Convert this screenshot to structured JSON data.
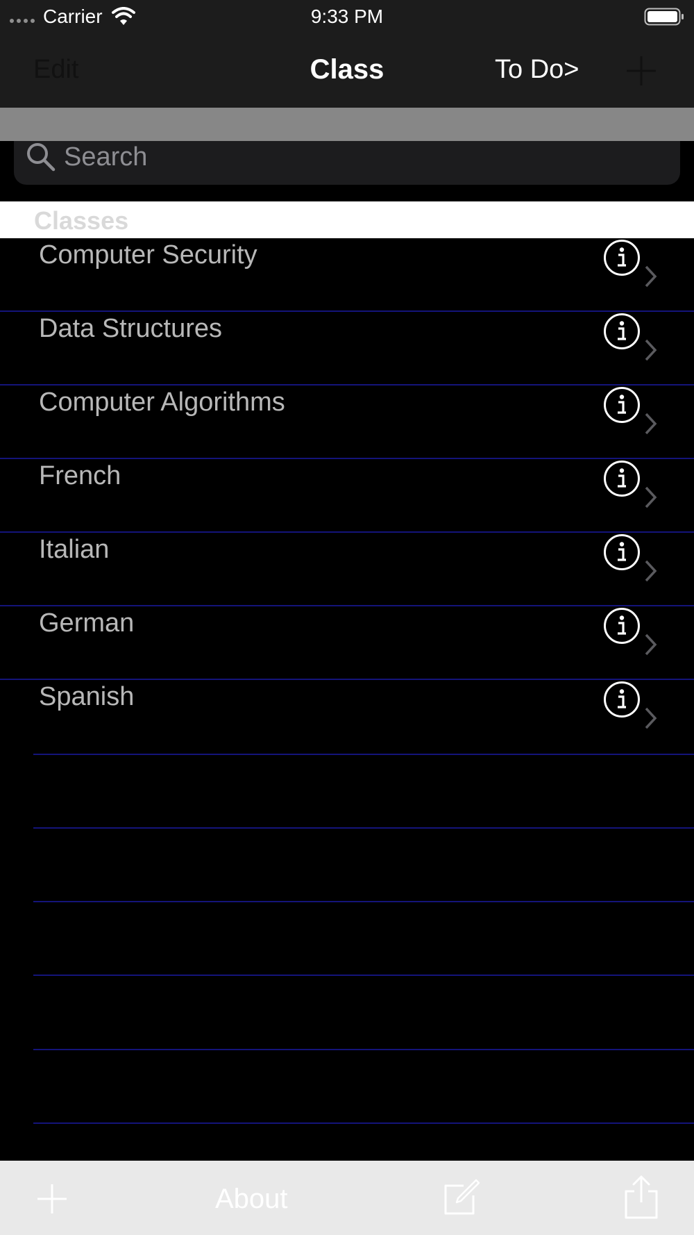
{
  "status_bar": {
    "carrier": "Carrier",
    "time": "9:33 PM"
  },
  "nav": {
    "edit_label": "Edit",
    "title": "Class",
    "todo_label": "To Do>",
    "add_icon": "plus-icon"
  },
  "search": {
    "placeholder": "Search"
  },
  "section": {
    "title": "Classes"
  },
  "classes": [
    {
      "name": "Computer Security"
    },
    {
      "name": "Data Structures"
    },
    {
      "name": "Computer Algorithms"
    },
    {
      "name": "French"
    },
    {
      "name": "Italian"
    },
    {
      "name": "German"
    },
    {
      "name": "Spanish"
    }
  ],
  "toolbar": {
    "about_label": "About"
  },
  "colors": {
    "nav_background": "#1c1c1c",
    "separator": "#14147a",
    "row_text": "#b8b8b8",
    "toolbar_background": "#e9e9e9"
  }
}
